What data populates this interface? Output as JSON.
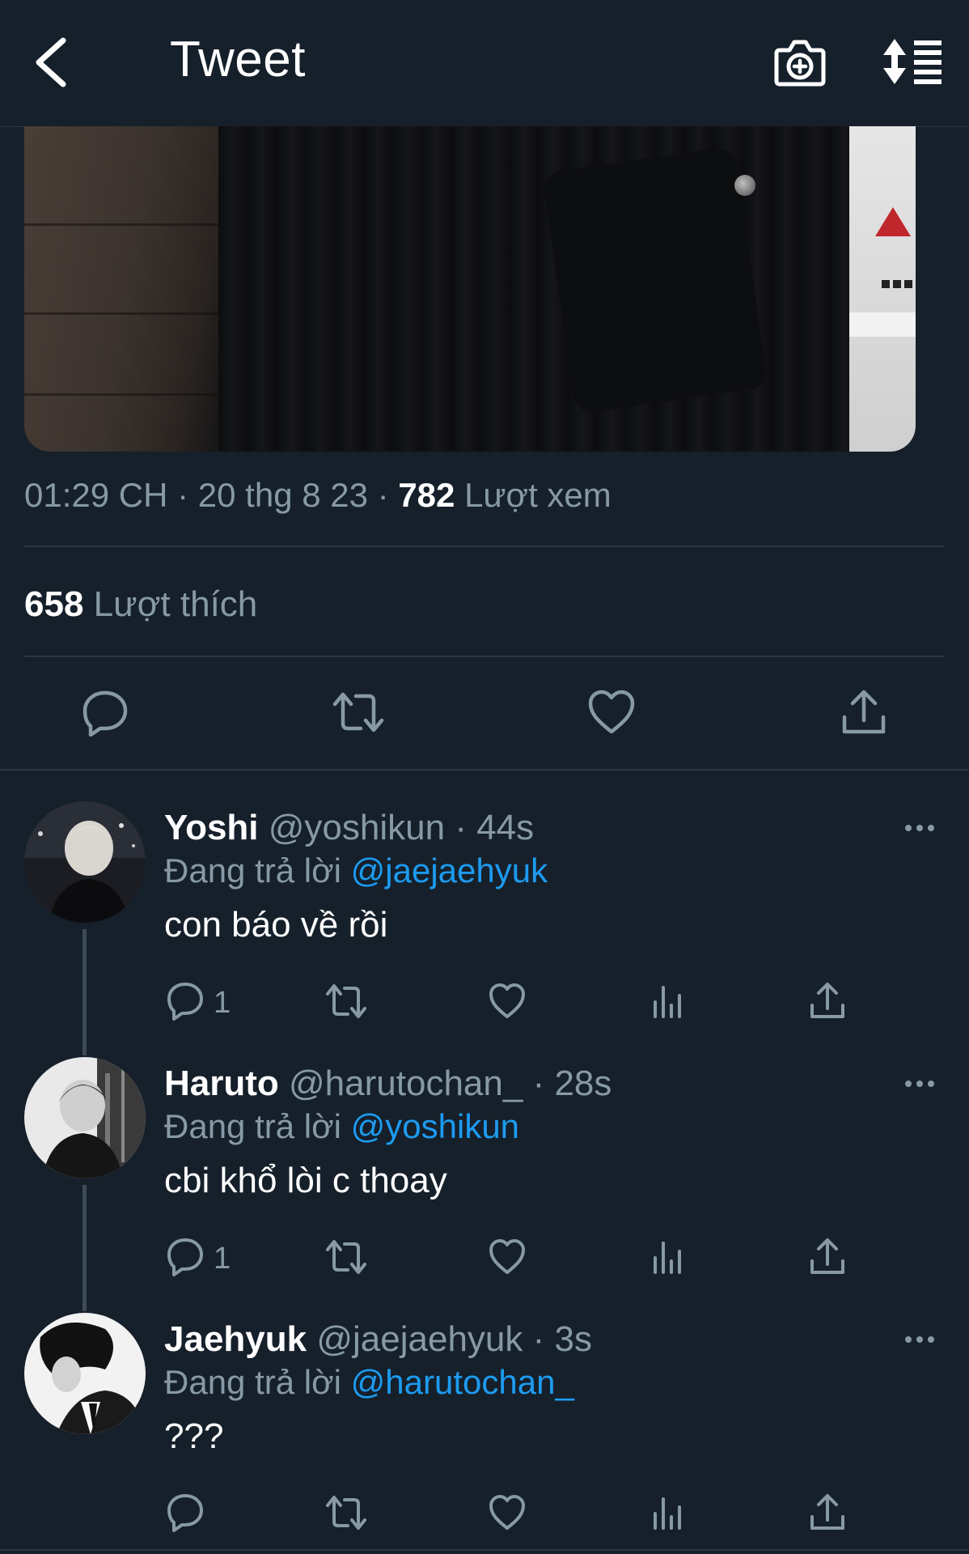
{
  "header": {
    "title": "Tweet"
  },
  "tweet": {
    "time": "01:29 CH",
    "separator": "·",
    "date": "20 thg 8 23",
    "views_count": "782",
    "views_label": "Lượt xem",
    "likes_count": "658",
    "likes_label": "Lượt thích"
  },
  "replies": [
    {
      "name": "Yoshi",
      "handle": "@yoshikun",
      "time": "· 44s",
      "replying_label": "Đang trả lời",
      "replying_to": "@jaejaehyuk",
      "text": "con báo về rồi",
      "reply_count": "1"
    },
    {
      "name": "Haruto",
      "handle": "@harutochan_",
      "time": "· 28s",
      "replying_label": "Đang trả lời",
      "replying_to": "@yoshikun",
      "text": "cbi khổ lòi c thoay",
      "reply_count": "1"
    },
    {
      "name": "Jaehyuk",
      "handle": "@jaejaehyuk",
      "time": "· 3s",
      "replying_label": "Đang trả lời",
      "replying_to": "@harutochan_",
      "text": "???",
      "reply_count": ""
    }
  ],
  "icons": {
    "back": "chevron-left-icon",
    "camera": "camera-plus-icon",
    "sort": "sort-icon",
    "reply": "reply-icon",
    "retweet": "retweet-icon",
    "like": "heart-icon",
    "share": "share-icon",
    "analytics": "analytics-icon",
    "more": "more-icon"
  },
  "colors": {
    "background": "#15202b",
    "secondary_text": "#8899a6",
    "link": "#1d9bf0",
    "divider": "#2c3640"
  }
}
